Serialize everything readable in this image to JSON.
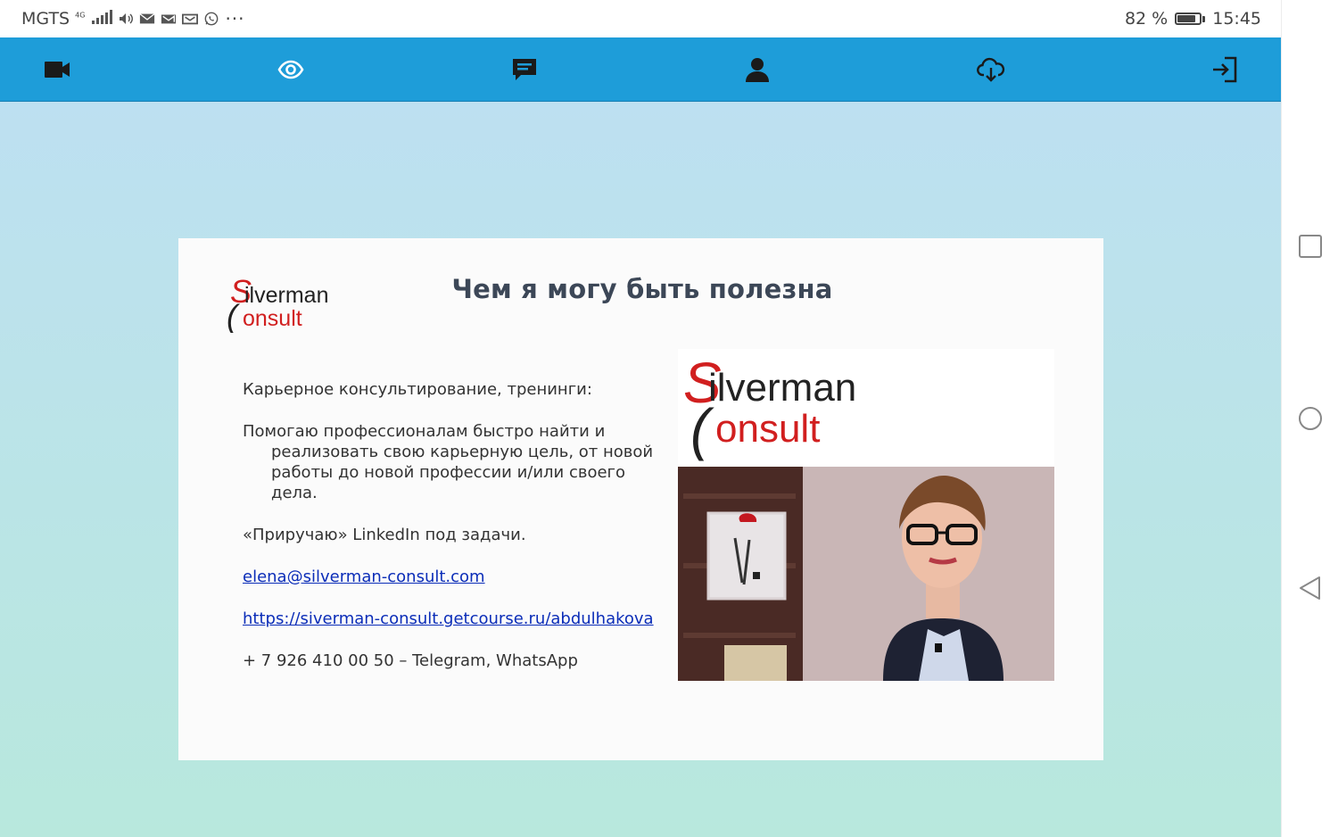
{
  "status_bar": {
    "carrier": "MGTS",
    "network": "4G",
    "battery_percent": "82 %",
    "battery_level": 0.82,
    "time": "15:45"
  },
  "toolbar": {
    "color": "#1e9dd9",
    "icons": [
      "video-camera-icon",
      "eye-icon",
      "chat-icon",
      "user-icon",
      "cloud-download-icon",
      "sign-in-icon"
    ]
  },
  "slide": {
    "title": "Чем я могу быть полезна",
    "logo": {
      "line1": "Silverman",
      "line2": "Consult"
    },
    "paragraphs": {
      "services": "Карьерное консультирование, тренинги:",
      "help": "Помогаю профессионалам быстро найти и реализовать свою карьерную цель, от новой работы до новой профессии и/или своего дела.",
      "linkedin": "«Приручаю» LinkedIn под задачи."
    },
    "email": "elena@silverman-consult.com",
    "url": "https://siverman-consult.getcourse.ru/abdulhakova",
    "phone": "+ 7 926 410 00 50 – Telegram, WhatsApp"
  },
  "nav_bar": {
    "icons": [
      "recent-apps-icon",
      "home-icon",
      "back-icon"
    ]
  }
}
